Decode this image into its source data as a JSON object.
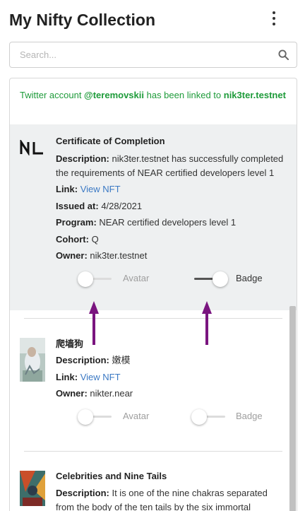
{
  "header": {
    "title": "My Nifty Collection"
  },
  "search": {
    "placeholder": "Search..."
  },
  "notice": {
    "prefix": "Twitter account ",
    "handle": "@teremovskii",
    "middle": " has been linked to ",
    "account": "nik3ter.testnet"
  },
  "cards": [
    {
      "title": "Certificate of Completion",
      "logo_text": "NL",
      "description_label": "Description:",
      "description": "nik3ter.testnet has successfully completed the requirements of NEAR certified developers level 1",
      "link_label": "Link:",
      "link_text": "View NFT",
      "issued_label": "Issued at:",
      "issued": "4/28/2021",
      "program_label": "Program:",
      "program": "NEAR certified developers level 1",
      "cohort_label": "Cohort:",
      "cohort": "Q",
      "owner_label": "Owner:",
      "owner": "nik3ter.testnet",
      "avatar_label": "Avatar",
      "badge_label": "Badge",
      "avatar_on": false,
      "badge_on": true
    },
    {
      "title": "爬墙狗",
      "description_label": "Description:",
      "description": "嫩模",
      "link_label": "Link:",
      "link_text": "View NFT",
      "owner_label": "Owner:",
      "owner": "nikter.near",
      "avatar_label": "Avatar",
      "badge_label": "Badge",
      "avatar_on": false,
      "badge_on": false
    },
    {
      "title": "Celebrities and Nine Tails",
      "description_label": "Description:",
      "description": "It is one of the nine chakras separated from the body of the ten tails by the six immortal"
    }
  ],
  "colors": {
    "notice_green": "#1e9b3a",
    "link_blue": "#3b79c4",
    "arrow_purple": "#7a157f",
    "selected_bg": "#eef0f1"
  },
  "icons": {
    "menu": "kebab-menu-icon",
    "search": "search-icon"
  }
}
